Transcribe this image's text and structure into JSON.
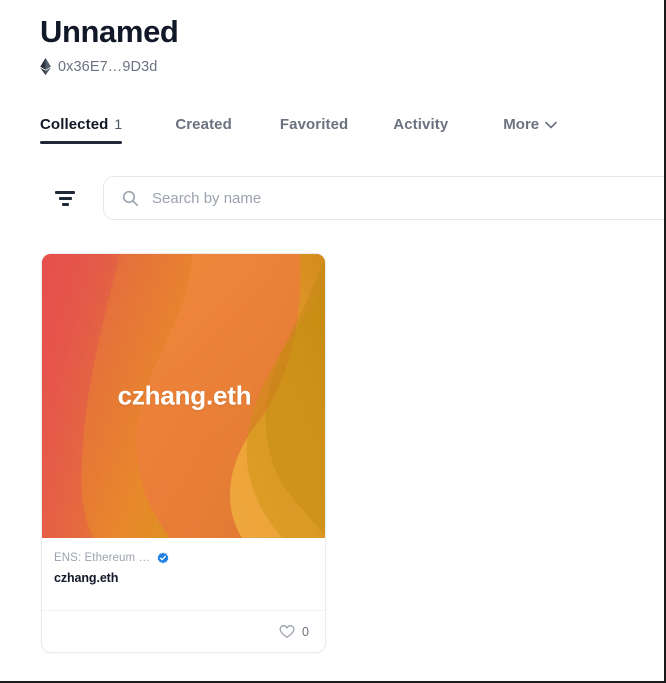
{
  "profile": {
    "title": "Unnamed",
    "address": "0x36E7…9D3d",
    "address_icon": "ethereum-diamond-icon"
  },
  "tabs": [
    {
      "label": "Collected",
      "count": "1",
      "active": true
    },
    {
      "label": "Created",
      "count": "",
      "active": false
    },
    {
      "label": "Favorited",
      "count": "",
      "active": false
    },
    {
      "label": "Activity",
      "count": "",
      "active": false
    }
  ],
  "more_menu": {
    "label": "More",
    "icon": "chevron-down-icon"
  },
  "toolbar": {
    "filter_icon": "filter-icon",
    "search_icon": "search-icon",
    "search_placeholder": "Search by name",
    "search_value": ""
  },
  "items": [
    {
      "media_label": "czhang.eth",
      "collection": "ENS: Ethereum …",
      "verified": true,
      "verified_icon": "verified-badge-icon",
      "name": "czhang.eth",
      "like_icon": "heart-icon",
      "likes": "0"
    }
  ],
  "colors": {
    "accent_red": "#e8544a",
    "accent_orange": "#e8822e",
    "accent_gold": "#eba33a",
    "accent_ochre": "#b8830e",
    "verified_blue": "#2081e2",
    "text_dark": "#111827",
    "text_muted": "#6b7280"
  }
}
